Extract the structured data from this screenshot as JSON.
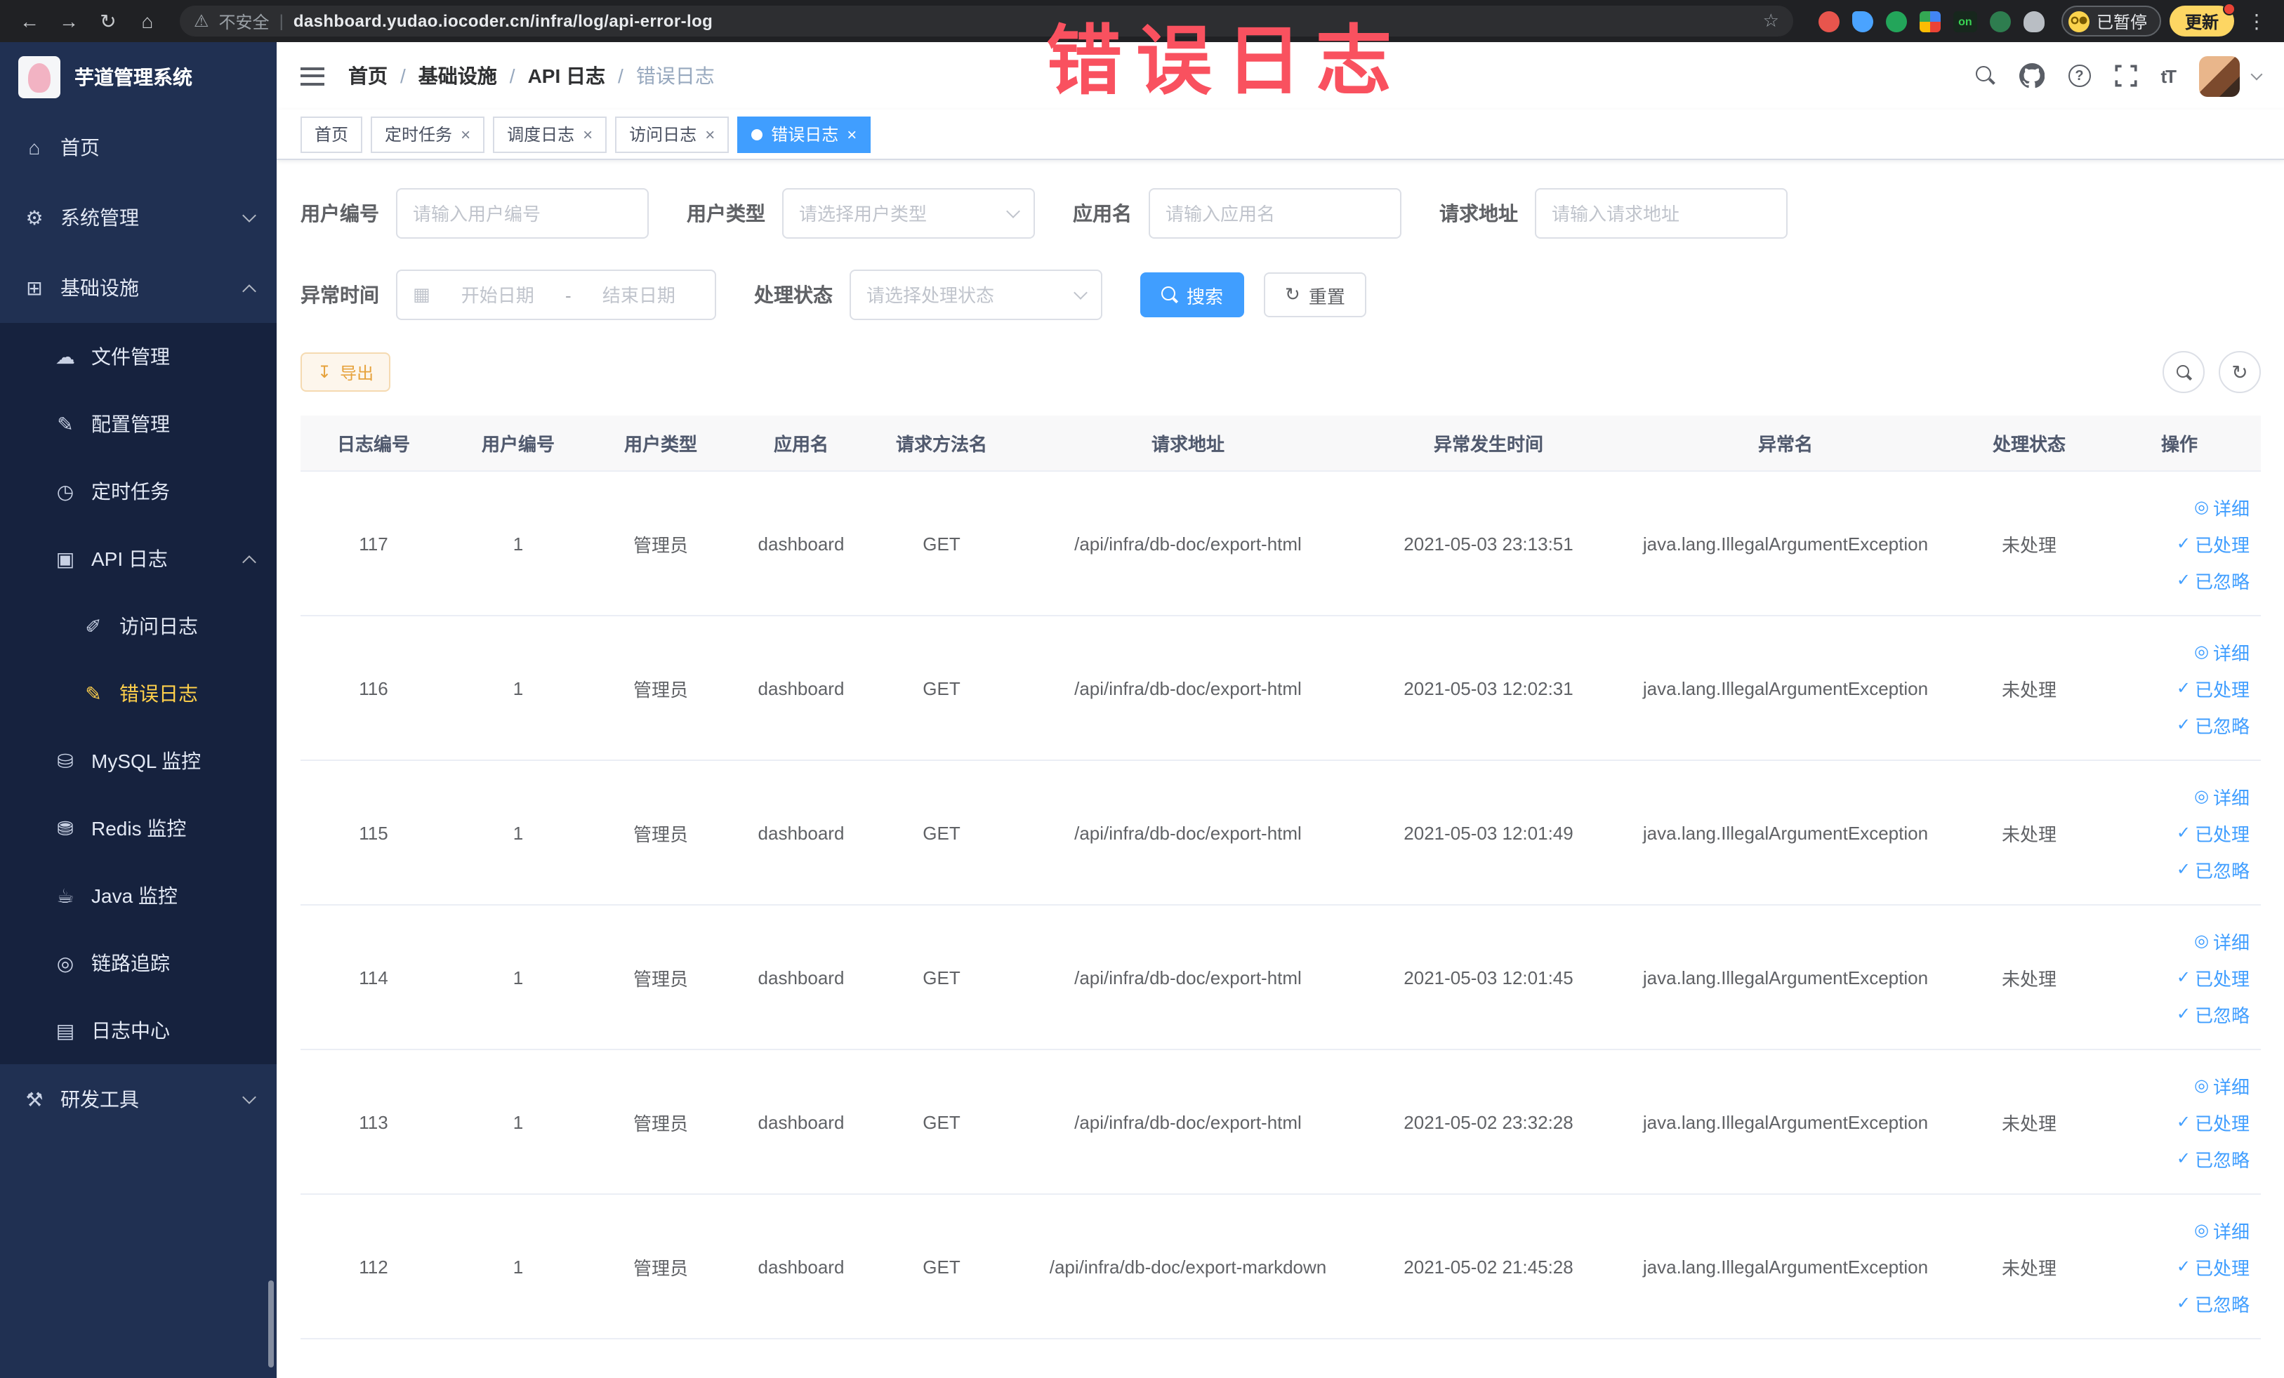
{
  "browser": {
    "security_label": "不安全",
    "separator": "|",
    "url": "dashboard.yudao.iocoder.cn/infra/log/api-error-log",
    "on_badge": "on",
    "paused_label": "已暂停",
    "update_label": "更新"
  },
  "annotation": {
    "title": "错误日志"
  },
  "sidebar": {
    "logo_title": "芋道管理系统",
    "items": [
      {
        "label": "首页"
      },
      {
        "label": "系统管理"
      },
      {
        "label": "基础设施"
      },
      {
        "label": "文件管理"
      },
      {
        "label": "配置管理"
      },
      {
        "label": "定时任务"
      },
      {
        "label": "API 日志"
      },
      {
        "label": "访问日志"
      },
      {
        "label": "错误日志"
      },
      {
        "label": "MySQL 监控"
      },
      {
        "label": "Redis 监控"
      },
      {
        "label": "Java 监控"
      },
      {
        "label": "链路追踪"
      },
      {
        "label": "日志中心"
      },
      {
        "label": "研发工具"
      }
    ]
  },
  "header": {
    "breadcrumb": [
      "首页",
      "基础设施",
      "API 日志",
      "错误日志"
    ],
    "separator": "/"
  },
  "tabs": [
    {
      "label": "首页",
      "closable": false,
      "active": false
    },
    {
      "label": "定时任务",
      "closable": true,
      "active": false
    },
    {
      "label": "调度日志",
      "closable": true,
      "active": false
    },
    {
      "label": "访问日志",
      "closable": true,
      "active": false
    },
    {
      "label": "错误日志",
      "closable": true,
      "active": true
    }
  ],
  "form": {
    "user_id": {
      "label": "用户编号",
      "placeholder": "请输入用户编号",
      "value": ""
    },
    "user_type": {
      "label": "用户类型",
      "placeholder": "请选择用户类型"
    },
    "app_name": {
      "label": "应用名",
      "placeholder": "请输入应用名",
      "value": ""
    },
    "request_url": {
      "label": "请求地址",
      "placeholder": "请输入请求地址",
      "value": ""
    },
    "exception_time": {
      "label": "异常时间",
      "start_placeholder": "开始日期",
      "separator": "-",
      "end_placeholder": "结束日期"
    },
    "process_status": {
      "label": "处理状态",
      "placeholder": "请选择处理状态"
    },
    "search_label": "搜索",
    "reset_label": "重置",
    "export_label": "导出"
  },
  "table": {
    "columns": [
      "日志编号",
      "用户编号",
      "用户类型",
      "应用名",
      "请求方法名",
      "请求地址",
      "异常发生时间",
      "异常名",
      "处理状态",
      "操作"
    ],
    "action_labels": {
      "detail": "详细",
      "processed": "已处理",
      "ignored": "已忽略"
    },
    "rows": [
      {
        "id": "117",
        "user_id": "1",
        "user_type": "管理员",
        "app": "dashboard",
        "method": "GET",
        "url": "/api/infra/db-doc/export-html",
        "time": "2021-05-03 23:13:51",
        "exception": "java.lang.IllegalArgumentException",
        "status": "未处理"
      },
      {
        "id": "116",
        "user_id": "1",
        "user_type": "管理员",
        "app": "dashboard",
        "method": "GET",
        "url": "/api/infra/db-doc/export-html",
        "time": "2021-05-03 12:02:31",
        "exception": "java.lang.IllegalArgumentException",
        "status": "未处理"
      },
      {
        "id": "115",
        "user_id": "1",
        "user_type": "管理员",
        "app": "dashboard",
        "method": "GET",
        "url": "/api/infra/db-doc/export-html",
        "time": "2021-05-03 12:01:49",
        "exception": "java.lang.IllegalArgumentException",
        "status": "未处理"
      },
      {
        "id": "114",
        "user_id": "1",
        "user_type": "管理员",
        "app": "dashboard",
        "method": "GET",
        "url": "/api/infra/db-doc/export-html",
        "time": "2021-05-03 12:01:45",
        "exception": "java.lang.IllegalArgumentException",
        "status": "未处理"
      },
      {
        "id": "113",
        "user_id": "1",
        "user_type": "管理员",
        "app": "dashboard",
        "method": "GET",
        "url": "/api/infra/db-doc/export-html",
        "time": "2021-05-02 23:32:28",
        "exception": "java.lang.IllegalArgumentException",
        "status": "未处理"
      },
      {
        "id": "112",
        "user_id": "1",
        "user_type": "管理员",
        "app": "dashboard",
        "method": "GET",
        "url": "/api/infra/db-doc/export-markdown",
        "time": "2021-05-02 21:45:28",
        "exception": "java.lang.IllegalArgumentException",
        "status": "未处理"
      }
    ]
  },
  "icons": {
    "back": "←",
    "forward": "→",
    "reload": "↻",
    "home": "⌂",
    "warning": "⚠",
    "star": "☆",
    "more": "⋮",
    "dashboard": "⌂",
    "system": "⚙",
    "infrastructure": "⊞",
    "file": "☁",
    "config": "✎",
    "job": "◷",
    "api_log": "▣",
    "access_log": "✐",
    "error_log": "✎",
    "mysql": "⛁",
    "redis": "⛃",
    "java": "☕",
    "tracing": "◎",
    "log_center": "▤",
    "dev_tools": "⚒",
    "close": "×",
    "calendar": "▦",
    "refresh": "↻",
    "download": "↧",
    "eye": "◎",
    "check": "✓",
    "question": "?",
    "font_size": "tT"
  }
}
